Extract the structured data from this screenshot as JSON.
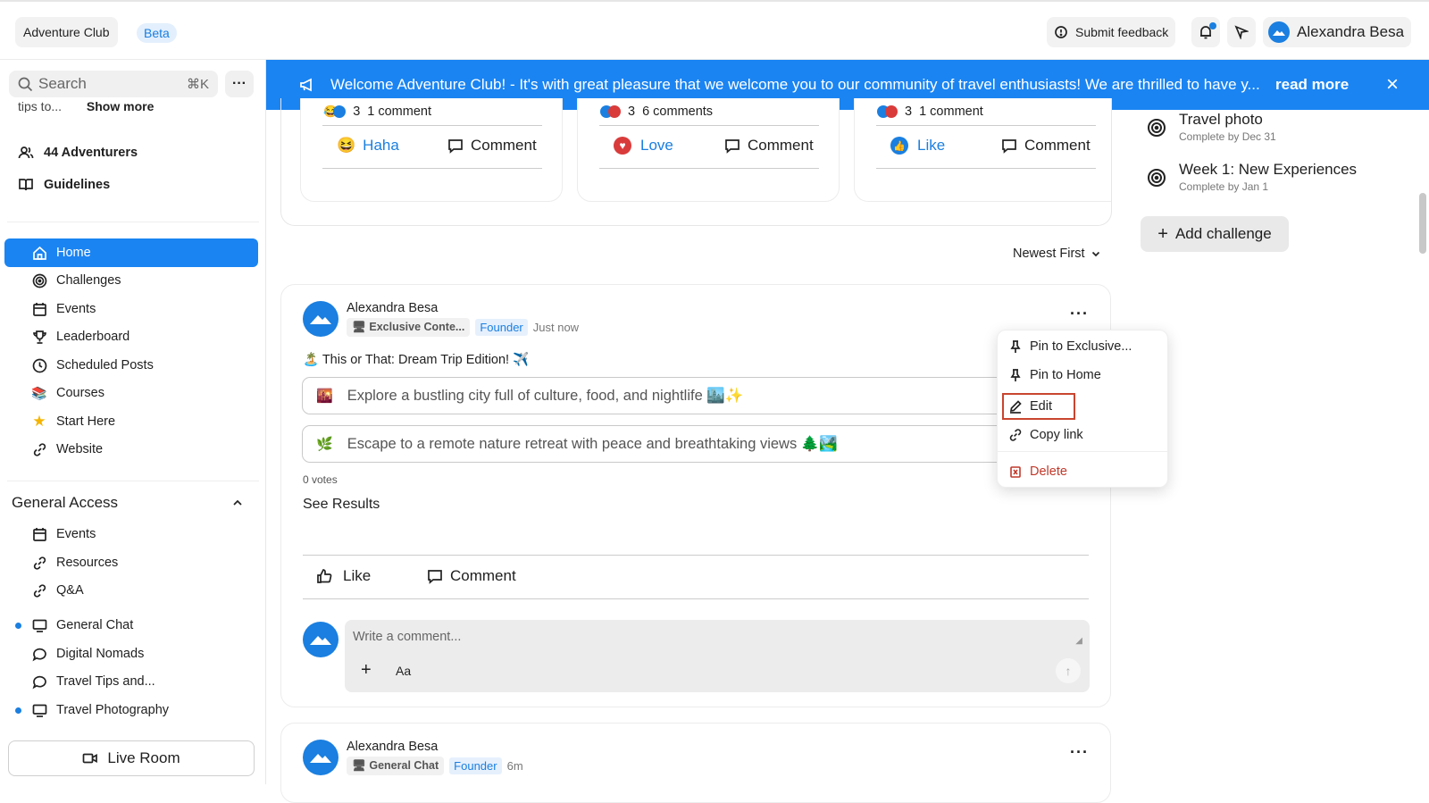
{
  "header": {
    "community_name": "Adventure Club",
    "beta_badge": "Beta",
    "feedback_label": "Submit feedback",
    "user_name": "Alexandra Besa"
  },
  "banner": {
    "text": "Welcome Adventure Club! - It's with great pleasure that we welcome you to our community of travel enthusiasts! We are thrilled to have y...",
    "read_more": "read more"
  },
  "sidebar": {
    "search_placeholder": "Search",
    "search_shortcut": "⌘K",
    "truncated_text": "tips to...",
    "show_more": "Show more",
    "members": "44 Adventurers",
    "guidelines": "Guidelines",
    "nav": [
      {
        "label": "Home",
        "icon": "home-icon"
      },
      {
        "label": "Challenges",
        "icon": "target-icon"
      },
      {
        "label": "Events",
        "icon": "calendar-icon"
      },
      {
        "label": "Leaderboard",
        "icon": "trophy-icon"
      },
      {
        "label": "Scheduled Posts",
        "icon": "clock-icon"
      },
      {
        "label": "Courses",
        "icon": "books-emoji"
      },
      {
        "label": "Start Here",
        "icon": "star-emoji"
      },
      {
        "label": "Website",
        "icon": "link-icon"
      }
    ],
    "section_title": "General Access",
    "section_items": [
      {
        "label": "Events",
        "icon": "calendar-icon",
        "unread": false
      },
      {
        "label": "Resources",
        "icon": "link-icon",
        "unread": false
      },
      {
        "label": "Q&A",
        "icon": "link-icon",
        "unread": false
      },
      {
        "label": "General Chat",
        "icon": "monitor-icon",
        "unread": true
      },
      {
        "label": "Digital Nomads",
        "icon": "chat-icon",
        "unread": false
      },
      {
        "label": "Travel Tips and...",
        "icon": "chat-icon",
        "unread": false
      },
      {
        "label": "Travel Photography",
        "icon": "monitor-icon",
        "unread": true
      }
    ],
    "live_room": "Live Room"
  },
  "featured": [
    {
      "count": "3",
      "comments": "1 comment",
      "reaction": "Haha",
      "comment_label": "Comment"
    },
    {
      "count": "3",
      "comments": "6 comments",
      "reaction": "Love",
      "comment_label": "Comment"
    },
    {
      "count": "3",
      "comments": "1 comment",
      "reaction": "Like",
      "comment_label": "Comment"
    }
  ],
  "sort": {
    "label": "Newest First"
  },
  "post": {
    "author": "Alexandra Besa",
    "space": "Exclusive Conte...",
    "role": "Founder",
    "time": "Just now",
    "title": "🏝️ This or That: Dream Trip Edition! ✈️",
    "options": [
      {
        "emoji": "🌇",
        "text": "Explore a bustling city full of culture, food, and nightlife 🏙️✨"
      },
      {
        "emoji": "🌿",
        "text": "Escape to a remote nature retreat with peace and breathtaking views 🌲🏞️"
      }
    ],
    "votes": "0 votes",
    "see_results": "See Results",
    "like": "Like",
    "comment": "Comment",
    "comment_placeholder": "Write a comment...",
    "format_label": "Aa"
  },
  "post2": {
    "author": "Alexandra Besa",
    "space": "General Chat",
    "role": "Founder",
    "time": "6m"
  },
  "menu": {
    "items": [
      "Pin to Exclusive...",
      "Pin to Home",
      "Edit",
      "Copy link"
    ],
    "delete": "Delete"
  },
  "challenges": {
    "items": [
      {
        "title": "Travel photo",
        "due": "Complete by Dec 31"
      },
      {
        "title": "Week 1: New Experiences",
        "due": "Complete by Jan 1"
      }
    ],
    "add_label": "Add challenge"
  },
  "colors": {
    "accent": "#1a84f2",
    "danger": "#c0392b",
    "highlight_border": "#c9452f"
  }
}
